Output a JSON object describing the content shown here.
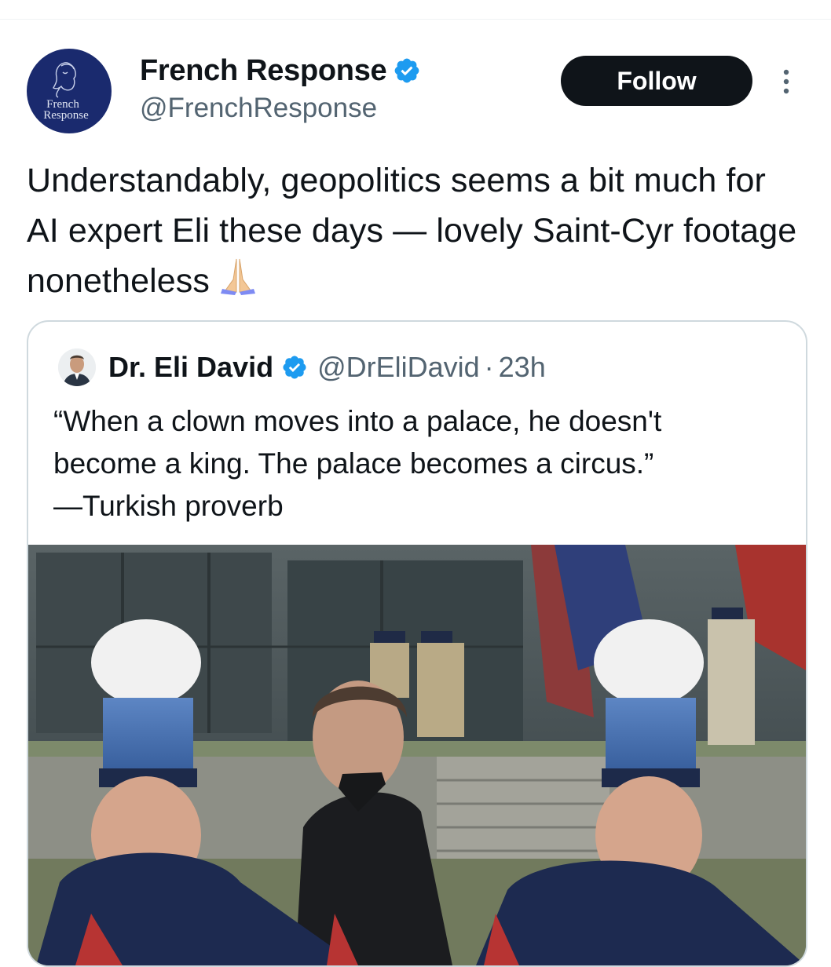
{
  "author": {
    "display_name": "French Response",
    "handle": "@FrenchResponse",
    "avatar_text_line1": "French",
    "avatar_text_line2": "Response",
    "avatar_icon": "marianne-logo-icon"
  },
  "follow_label": "Follow",
  "tweet": {
    "text": "Understandably, geopolitics seems a bit much for AI expert Eli these days — lovely Saint-Cyr footage nonetheless",
    "emoji": "folded-hands-emoji"
  },
  "quoted": {
    "display_name": "Dr. Eli David",
    "handle": "@DrEliDavid",
    "separator": "·",
    "time": "23h",
    "text_line1": "“When a clown moves into a palace, he doesn't",
    "text_line2": "become a king. The palace becomes a circus.”",
    "text_line3": "—Turkish proverb"
  },
  "colors": {
    "verified_blue": "#1d9bf0",
    "text_primary": "#0f1419",
    "text_secondary": "#536471",
    "follow_bg": "#0f1419",
    "avatar_bg": "#1a2a6e"
  }
}
